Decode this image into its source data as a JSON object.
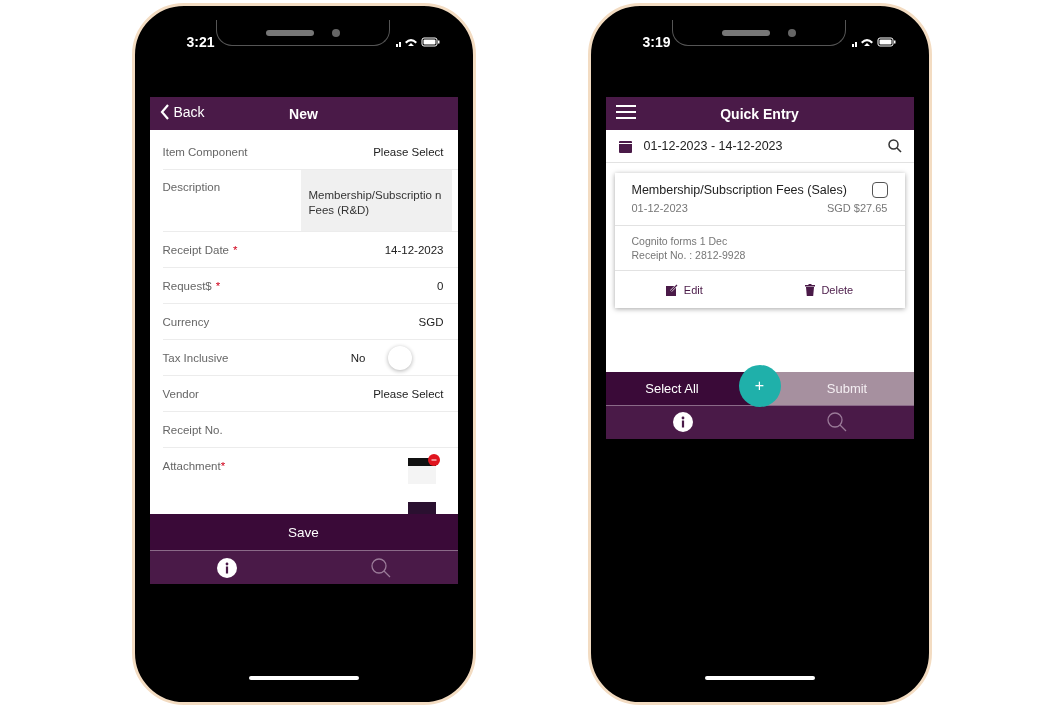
{
  "phones": [
    {
      "kind": "form",
      "status_time": "3:21",
      "header": {
        "back": "Back",
        "title": "New"
      },
      "fields": [
        {
          "kind": "select",
          "label": "Item Component",
          "value": "Please Select"
        },
        {
          "kind": "textarea",
          "label": "Description",
          "value": "Membership/Subscriptio n Fees (R&D)"
        },
        {
          "kind": "text",
          "label": "Receipt Date",
          "required_mark": "*",
          "value": "14-12-2023"
        },
        {
          "kind": "text",
          "label": "Request$",
          "required_mark": "*",
          "value": "0"
        },
        {
          "kind": "text",
          "label": "Currency",
          "value": "SGD"
        },
        {
          "kind": "toggle",
          "label": "Tax Inclusive",
          "value": "No",
          "on": false
        },
        {
          "kind": "select",
          "label": "Vendor",
          "value": "Please Select"
        },
        {
          "kind": "text",
          "label": "Receipt No."
        },
        {
          "kind": "attachment",
          "label": "Attachment",
          "required_mark": "*"
        }
      ],
      "save": "Save",
      "tabs": [
        {
          "selected": true
        },
        {
          "selected": false
        }
      ]
    },
    {
      "kind": "list",
      "status_time": "3:19",
      "header": {
        "title": "Quick Entry"
      },
      "date_range": "01-12-2023 - 14-12-2023",
      "cards": [
        {
          "title": "Membership/Subscription Fees (Sales)",
          "checked": false,
          "date": "01-12-2023",
          "amount": "SGD $27.65",
          "note": "Cognito forms 1 Dec",
          "receipt": "Receipt No. : 2812-9928",
          "edit": "Edit",
          "delete": "Delete"
        }
      ],
      "select_all": "Select All",
      "submit": "Submit",
      "submit_disabled": true,
      "fab": "+",
      "tabs": [
        {
          "selected": true
        },
        {
          "selected": false
        }
      ]
    }
  ]
}
